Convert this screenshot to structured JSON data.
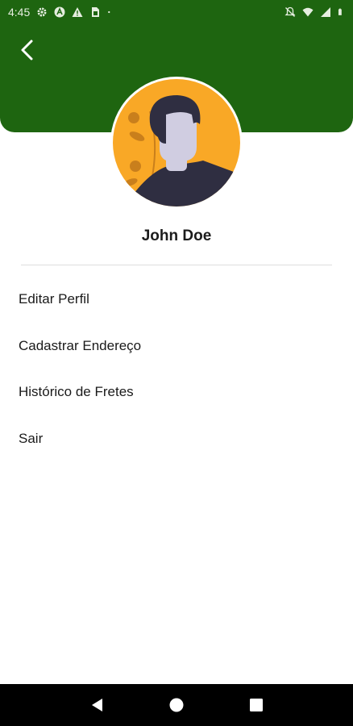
{
  "status_bar": {
    "time": "4:45",
    "left_icons": [
      "settings-icon",
      "vpn-icon",
      "warning-icon",
      "sim-card-icon",
      "dot-icon"
    ],
    "right_icons": [
      "notifications-off-icon",
      "wifi-icon",
      "signal-icon",
      "battery-icon"
    ]
  },
  "colors": {
    "header_bg": "#1e6510",
    "avatar_bg": "#f9a826",
    "hair": "#2f2e41",
    "skin": "#d0cde1"
  },
  "profile": {
    "name": "John Doe"
  },
  "menu": {
    "items": [
      {
        "label": "Editar Perfil"
      },
      {
        "label": "Cadastrar Endereço"
      },
      {
        "label": "Histórico de Fretes"
      },
      {
        "label": "Sair"
      }
    ]
  },
  "nav": {
    "buttons": [
      "back-icon",
      "home-icon",
      "recents-icon"
    ]
  }
}
